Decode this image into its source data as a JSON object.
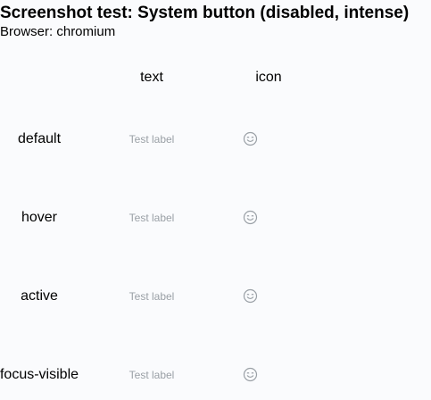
{
  "page": {
    "title": "Screenshot test: System button (disabled, intense)",
    "subtitle": "Browser: chromium"
  },
  "columns": {
    "text": "text",
    "icon": "icon"
  },
  "rows": [
    {
      "state": "default",
      "button_label": "Test label",
      "icon": "smiley-face-icon"
    },
    {
      "state": "hover",
      "button_label": "Test label",
      "icon": "smiley-face-icon"
    },
    {
      "state": "active",
      "button_label": "Test label",
      "icon": "smiley-face-icon"
    },
    {
      "state": "focus-visible",
      "button_label": "Test label",
      "icon": "smiley-face-icon"
    }
  ],
  "colors": {
    "background": "#fafbfd",
    "disabled_text": "#9aa0a6",
    "disabled_icon": "#9aa0a6"
  }
}
